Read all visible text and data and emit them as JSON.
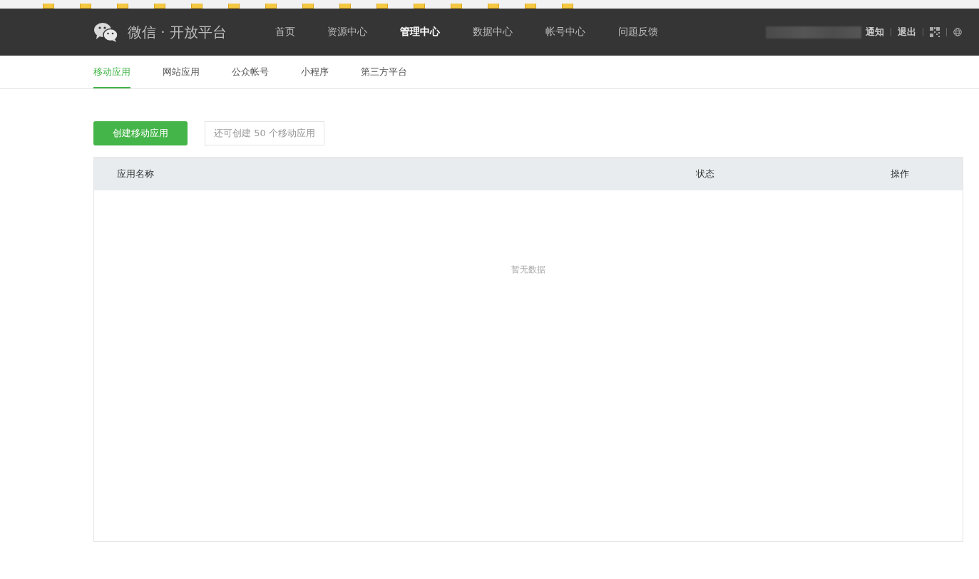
{
  "header": {
    "logo": "微信 · 开放平台",
    "nav": [
      {
        "label": "首页",
        "selected": false
      },
      {
        "label": "资源中心",
        "selected": false
      },
      {
        "label": "管理中心",
        "selected": true
      },
      {
        "label": "数据中心",
        "selected": false
      },
      {
        "label": "帐号中心",
        "selected": false
      },
      {
        "label": "问题反馈",
        "selected": false
      }
    ],
    "links": [
      "通知",
      "退出"
    ]
  },
  "tabs": [
    {
      "label": "移动应用",
      "selected": true
    },
    {
      "label": "网站应用",
      "selected": false
    },
    {
      "label": "公众帐号",
      "selected": false
    },
    {
      "label": "小程序",
      "selected": false
    },
    {
      "label": "第三方平台",
      "selected": false
    }
  ],
  "create_button": "创建移动应用",
  "quota_tip": "还可创建 50 个移动应用",
  "table": {
    "columns": [
      "应用名称",
      "状态",
      "操作"
    ],
    "empty_text": "暂无数据"
  }
}
